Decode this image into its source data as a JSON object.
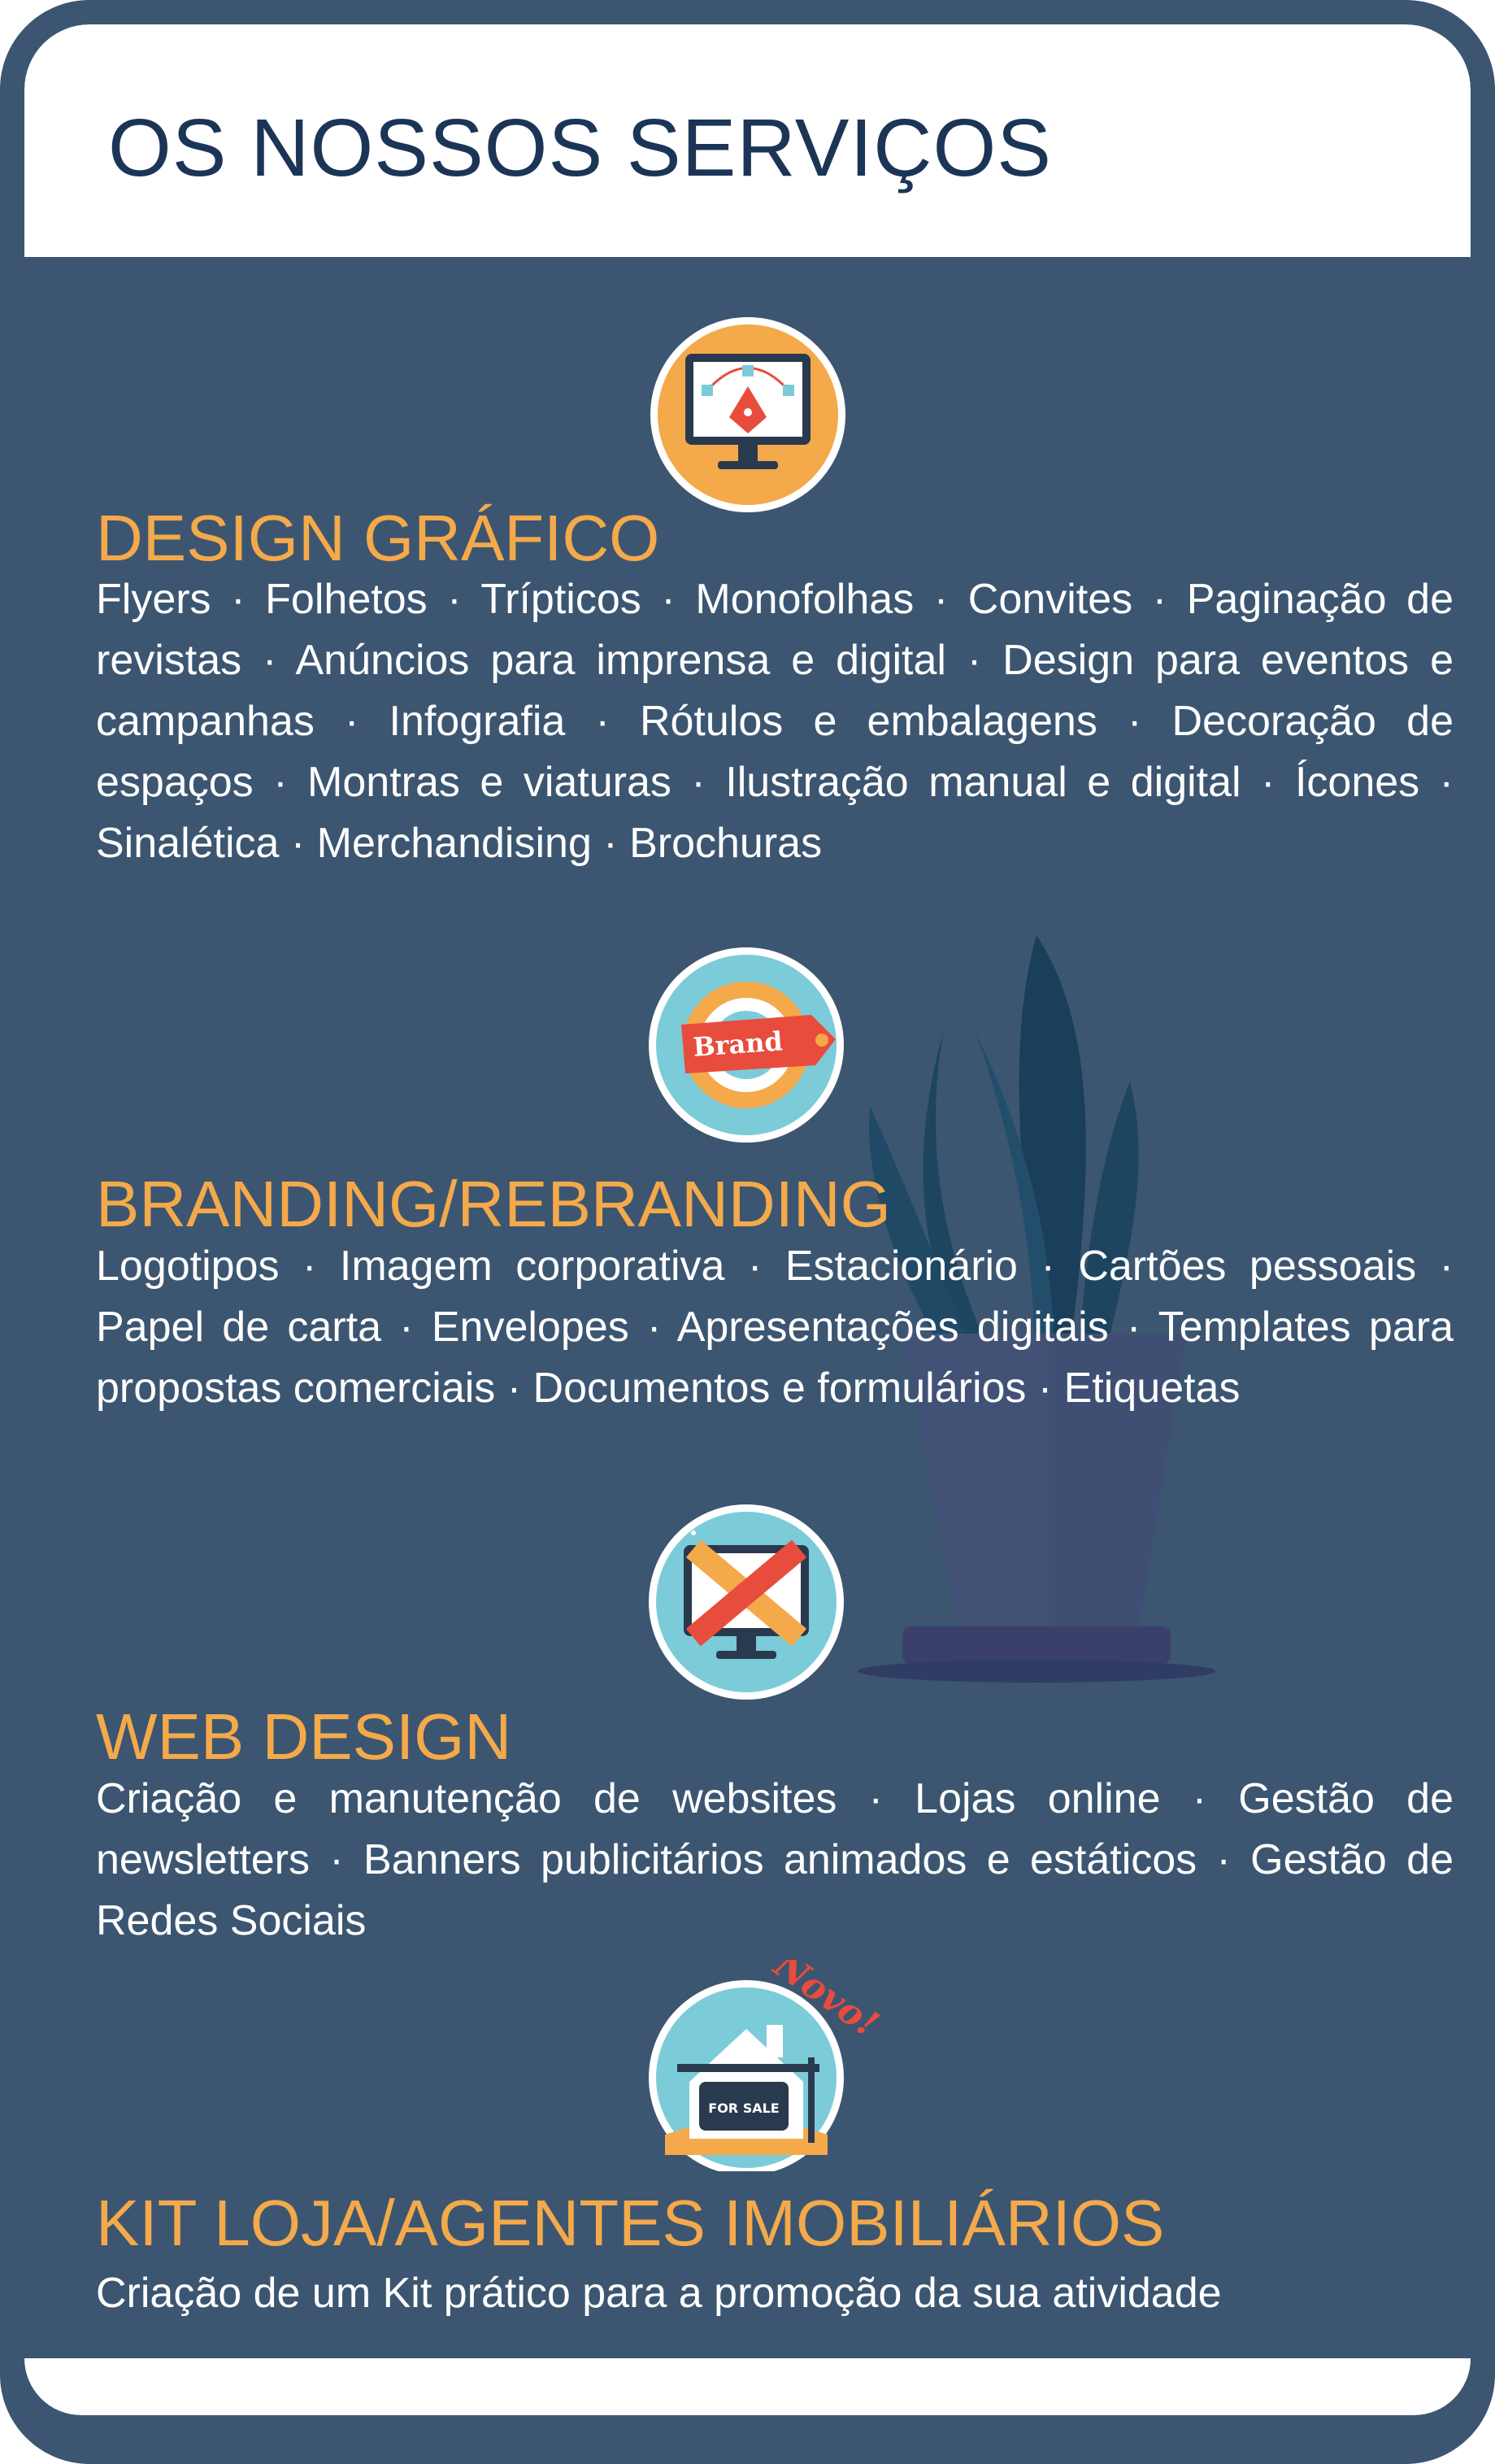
{
  "page": {
    "title": "OS NOSSOS SERVIÇOS"
  },
  "colors": {
    "background": "#3c5671",
    "title": "#1c3556",
    "accent": "#f4a94a",
    "text": "#ffffff"
  },
  "sections": [
    {
      "title": "DESIGN GRÁFICO",
      "icon": "pen-tool-monitor-icon",
      "text": "Flyers · Folhetos · Trípticos · Monofolhas · Convites · Paginação de revistas · Anúncios para imprensa e digital · Design para eventos e campanhas · Infografia · Rótulos e embalagens · Decoração de espaços · Montras e viaturas · Ilustração manual e digital · Ícones · Sinalética · Merchandising · Brochuras"
    },
    {
      "title": "BRANDING/REBRANDING",
      "icon": "brand-tag-icon",
      "icon_text": "Brand",
      "text": "Logotipos · Imagem corporativa · Estacionário · Cartões pessoais · Papel de carta · Envelopes · Apresentações digitais · Templates para propostas comerciais · Documentos e formulários · Etiquetas"
    },
    {
      "title": "WEB DESIGN",
      "icon": "pencil-ruler-monitor-icon",
      "text": "Criação e manutenção de websites · Lojas online · Gestão de newsletters · Banners publicitários animados e estáticos · Gestão de Redes Sociais"
    },
    {
      "title": "KIT LOJA/AGENTES IMOBILIÁRIOS",
      "icon": "house-for-sale-icon",
      "icon_text": "FOR SALE",
      "badge": "Novo!",
      "text": "Criação de um Kit prático para a promoção da sua atividade"
    }
  ]
}
